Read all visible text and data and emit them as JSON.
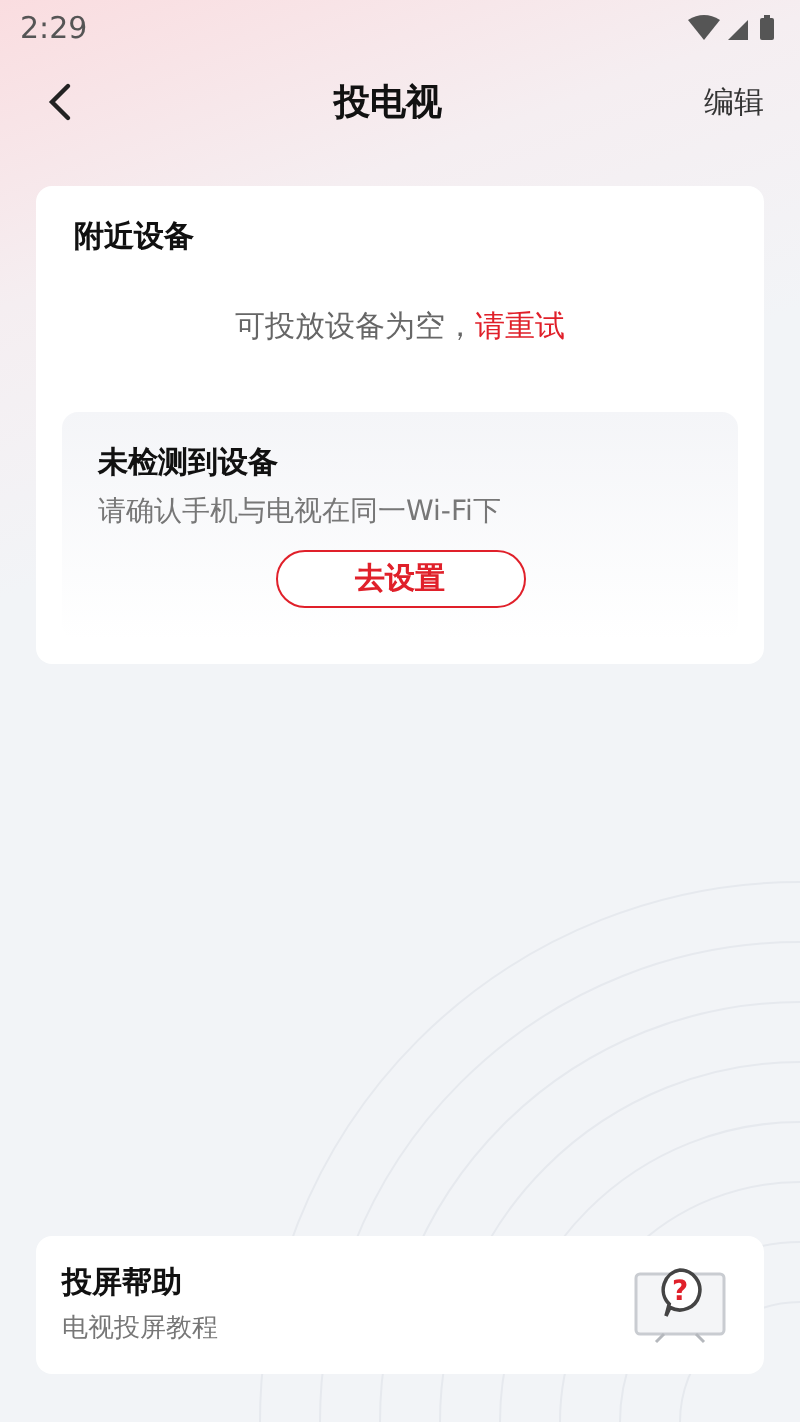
{
  "status_bar": {
    "time": "2:29"
  },
  "header": {
    "title": "投电视",
    "action": "编辑"
  },
  "nearby": {
    "title": "附近设备",
    "empty_text": "可投放设备为空，",
    "retry_link": "请重试",
    "notice": {
      "title": "未检测到设备",
      "hint": "请确认手机与电视在同一Wi-Fi下",
      "button": "去设置"
    }
  },
  "help": {
    "title": "投屏帮助",
    "subtitle": "电视投屏教程",
    "icon_glyph": "?"
  }
}
